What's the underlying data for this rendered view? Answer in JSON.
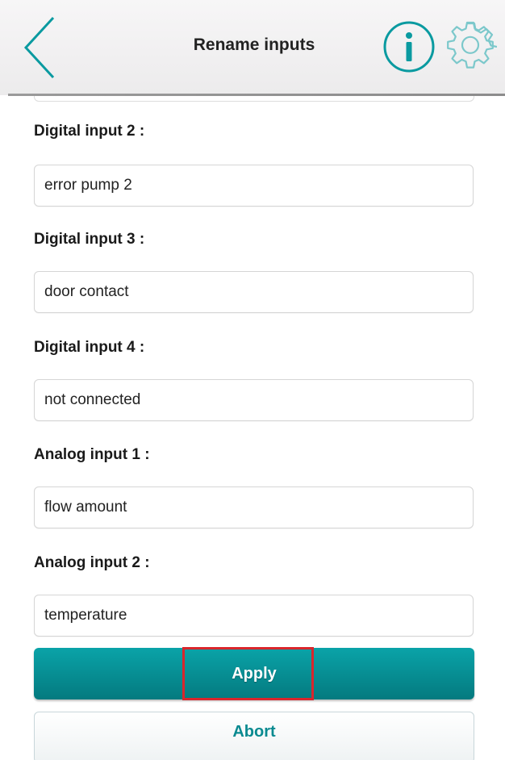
{
  "header": {
    "title": "Rename inputs",
    "back_icon": "chevron-left-icon",
    "info_icon": "info-icon",
    "settings_icon": "gear-icon",
    "accent_color": "#0a9aa0"
  },
  "fields": [
    {
      "label": "Digital input 2 :",
      "value": "error pump 2"
    },
    {
      "label": "Digital input 3 :",
      "value": "door contact"
    },
    {
      "label": "Digital input 4 :",
      "value": "not connected"
    },
    {
      "label": "Analog input 1 :",
      "value": "flow amount"
    },
    {
      "label": "Analog input 2 :",
      "value": "temperature"
    }
  ],
  "actions": {
    "apply_label": "Apply",
    "abort_label": "Abort",
    "apply_color": "#047a7f",
    "highlight_color": "#d9262c"
  }
}
